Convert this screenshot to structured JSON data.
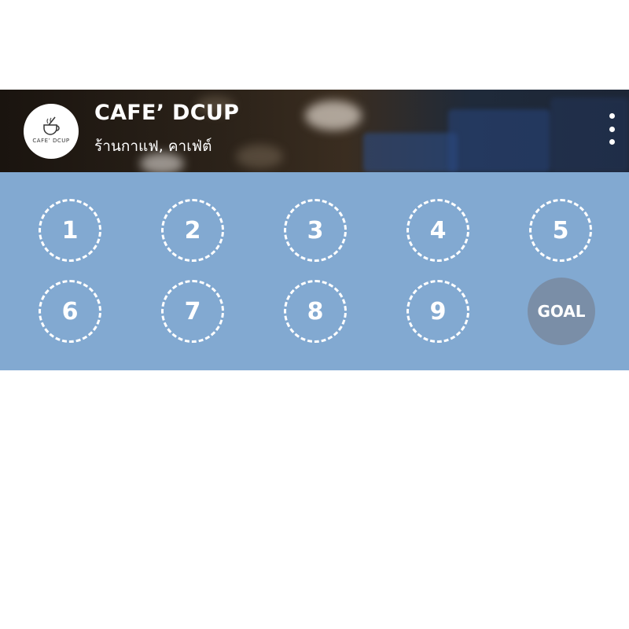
{
  "shop": {
    "name": "CAFE’ DCUP",
    "category": "ร้านกาแฟ, คาเฟ่ต์",
    "logo_text": "CAFE’ DCUP"
  },
  "menu": {
    "icon": "more-vertical-icon"
  },
  "stamps": {
    "slots": [
      "1",
      "2",
      "3",
      "4",
      "5",
      "6",
      "7",
      "8",
      "9"
    ],
    "goal_label": "GOAL"
  },
  "colors": {
    "stamp_area": "#82a9d1",
    "goal_circle": "#7a8ea7",
    "text": "#ffffff"
  }
}
